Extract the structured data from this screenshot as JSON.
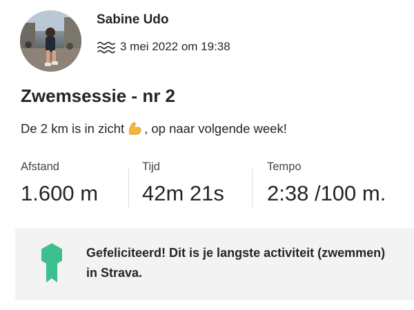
{
  "activity": {
    "athlete_name": "Sabine Udo",
    "activity_icon": "swim-icon",
    "datetime": "3 mei 2022 om 19:38",
    "title": "Zwemsessie - nr 2",
    "description_before": "De 2 km is in zicht",
    "description_emoji": "flexed-biceps-emoji",
    "description_after": ", op naar volgende week!"
  },
  "stats": [
    {
      "label": "Afstand",
      "value": "1.600 m"
    },
    {
      "label": "Tijd",
      "value": "42m 21s"
    },
    {
      "label": "Tempo",
      "value": "2:38 /100 m."
    }
  ],
  "achievement": {
    "icon": "badge-icon",
    "text": "Gefeliciteerd! Dit is je langste activiteit (zwemmen) in Strava.",
    "accent_color": "#3dbf8f"
  }
}
